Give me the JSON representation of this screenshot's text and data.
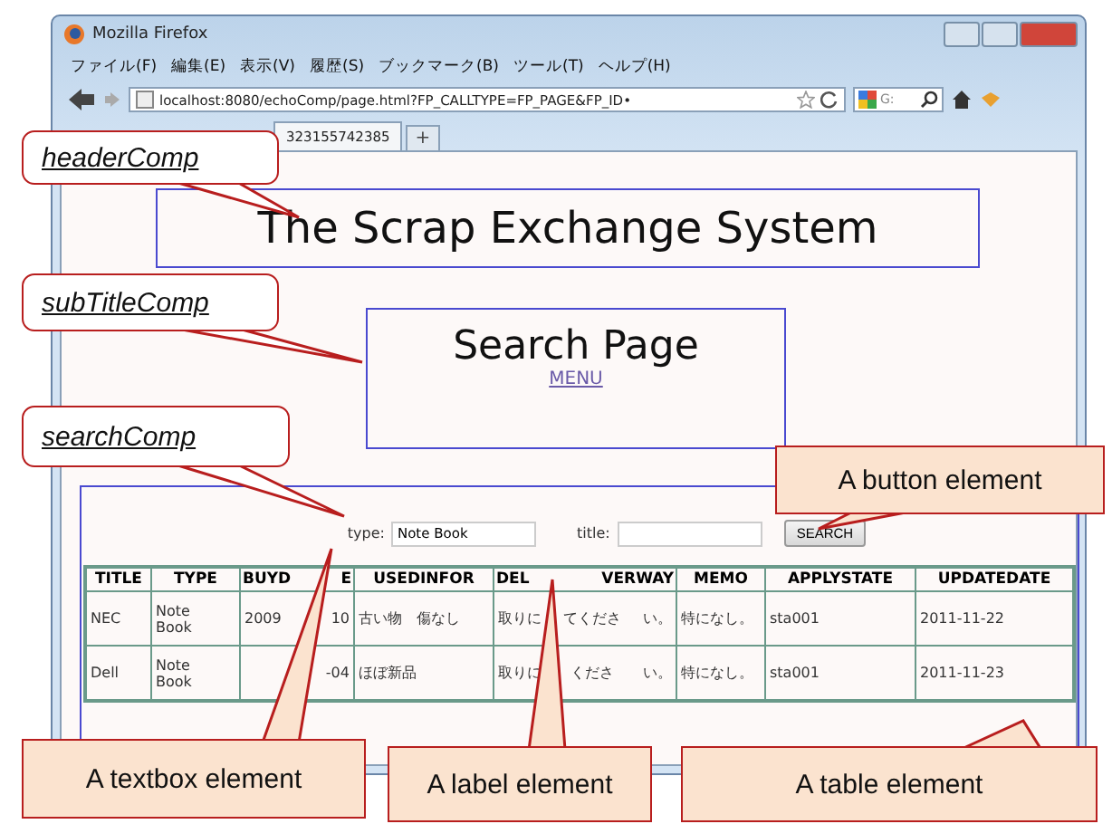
{
  "window": {
    "title": "Mozilla Firefox"
  },
  "menu": [
    "ファイル(F)",
    "編集(E)",
    "表示(V)",
    "履歴(S)",
    "ブックマーク(B)",
    "ツール(T)",
    "ヘルプ(H)"
  ],
  "address_bar": {
    "value": "localhost:8080/echoComp/page.html?FP_CALLTYPE=FP_PAGE&FP_ID•"
  },
  "search_box": {
    "value": "G:"
  },
  "tabs": [
    {
      "label": "323155742385",
      "selected": true
    }
  ],
  "new_tab": "+",
  "page": {
    "header": "The Scrap Exchange System",
    "subtitle": "Search Page",
    "menu_link": "MENU",
    "search": {
      "type_label": "type:",
      "type_value": "Note Book",
      "title_label": "title:",
      "button": "SEARCH"
    },
    "table": {
      "columns": [
        {
          "parts": [
            "TITLE"
          ]
        },
        {
          "parts": [
            "TYPE"
          ]
        },
        {
          "parts": [
            "BUYD",
            "E"
          ]
        },
        {
          "parts": [
            "USEDINFOR"
          ]
        },
        {
          "parts": [
            "DEL",
            "VERWAY"
          ]
        },
        {
          "parts": [
            "MEMO"
          ]
        },
        {
          "parts": [
            "APPLYSTATE"
          ]
        },
        {
          "parts": [
            "UPDATEDATE"
          ]
        }
      ],
      "rows": [
        [
          {
            "parts": [
              "NEC"
            ]
          },
          {
            "parts": [
              "Note Book"
            ]
          },
          {
            "parts": [
              "2009",
              "10"
            ]
          },
          {
            "parts": [
              "古い物　傷なし"
            ]
          },
          {
            "parts": [
              "取りに",
              "てくださ",
              "い。"
            ]
          },
          {
            "parts": [
              "特になし。"
            ]
          },
          {
            "parts": [
              "sta001"
            ]
          },
          {
            "parts": [
              "2011-11-22"
            ]
          }
        ],
        [
          {
            "parts": [
              "Dell"
            ]
          },
          {
            "parts": [
              "Note Book"
            ]
          },
          {
            "parts": [
              "-04"
            ]
          },
          {
            "parts": [
              "ほぼ新品"
            ]
          },
          {
            "parts": [
              "取りに",
              "くださ",
              "い。"
            ]
          },
          {
            "parts": [
              "特になし。"
            ]
          },
          {
            "parts": [
              "sta001"
            ]
          },
          {
            "parts": [
              "2011-11-23"
            ]
          }
        ]
      ]
    }
  },
  "annotations": [
    {
      "text": "headerComp",
      "kind": "tag"
    },
    {
      "text": "subTitleComp",
      "kind": "tag"
    },
    {
      "text": "searchComp",
      "kind": "tag"
    },
    {
      "text": "A button element",
      "kind": "note"
    },
    {
      "text": "A textbox element",
      "kind": "note"
    },
    {
      "text": "A label element",
      "kind": "note"
    },
    {
      "text": "A table element",
      "kind": "note"
    }
  ]
}
